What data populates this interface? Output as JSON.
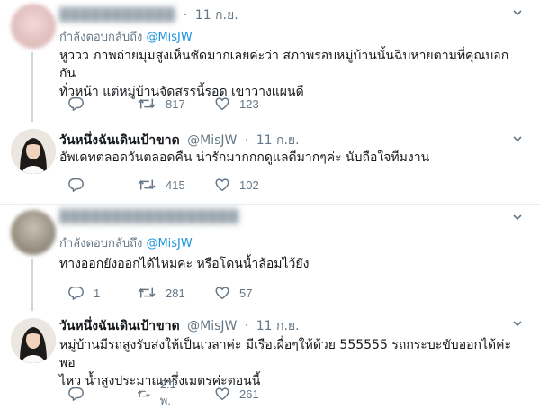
{
  "tweets": [
    {
      "name": "Redacted name",
      "time": "11 ก.ย.",
      "reply_label": "กำลังตอบกลับถึง",
      "reply_mention": "@MisJW",
      "text_line1": "หูววว ภาพถ่ายมุมสูงเห็นชัดมากเลยค่ะว่า สภาพรอบหมู่บ้านนั้นฉิบหายตามที่คุณบอก กัน",
      "text_line2": "ทั่วหน้า แต่หมู่บ้านจัดสรรนี้รอด เขาวางแผนดี",
      "replies": "",
      "retweets": "817",
      "likes": "123"
    },
    {
      "name": "วันหนึ่งฉันเดินเป้าขาด",
      "handle": "@MisJW",
      "time": "11 ก.ย.",
      "text_line1": "อัพเดทตลอดวันตลอดคืน น่ารักมากกกดูแลดีมากๆค่ะ นับถือใจทีมงาน",
      "replies": "",
      "retweets": "415",
      "likes": "102"
    },
    {
      "name": "Redacted name",
      "time": "11 ก.ย.",
      "reply_label": "กำลังตอบกลับถึง",
      "reply_mention": "@MisJW",
      "text_line1": "ทางออกยังออกได้ไหมคะ หรือโดนน้ำล้อมไว้ยัง",
      "replies": "1",
      "retweets": "281",
      "likes": "57"
    },
    {
      "name": "วันหนึ่งฉันเดินเป้าขาด",
      "handle": "@MisJW",
      "time": "11 ก.ย.",
      "text_line1": "หมู่บ้านมีรถสูงรับส่งให้เป็นเวลาค่ะ มีเรือเผื่อๆให้ด้วย 555555 รถกระบะขับออกได้ค่ะพอ",
      "text_line2": "ไหว น้ำสูงประมาณครึ่งเมตรค่ะตอนนี้",
      "replies": "",
      "retweets": "2.1 พ.",
      "likes": "261"
    }
  ],
  "colors": {
    "text": "#14171a",
    "secondary": "#657786",
    "link": "#1b95e0",
    "divider": "#e6ecf0",
    "thread": "#ccd6dd"
  },
  "icons": [
    "reply-icon",
    "retweet-icon",
    "like-icon",
    "chevron-down-icon"
  ]
}
